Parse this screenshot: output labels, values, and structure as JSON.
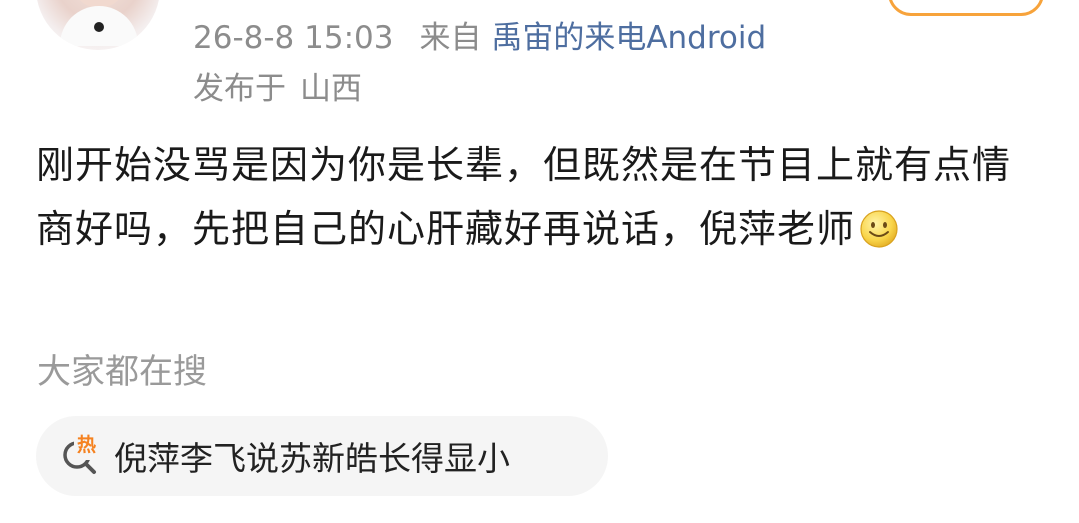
{
  "post": {
    "timestamp": "26-8-8 15:03",
    "source_prefix": "来自",
    "source": "禹宙的来电Android",
    "location_prefix": "发布于",
    "location": "山西",
    "content": "刚开始没骂是因为你是长辈，但既然是在节目上就有点情商好吗，先把自己的心肝藏好再说话，倪萍老师",
    "emoji": "smile-emoji"
  },
  "search": {
    "label": "大家都在搜",
    "hot_badge": "热",
    "hot_query": "倪萍李飞说苏新皓长得显小"
  },
  "colors": {
    "source_link": "#4e6ea0",
    "meta_text": "#8c8c8c",
    "follow_border": "#f7a33b",
    "hot_badge": "#f58220",
    "chip_bg": "#f5f5f5"
  }
}
